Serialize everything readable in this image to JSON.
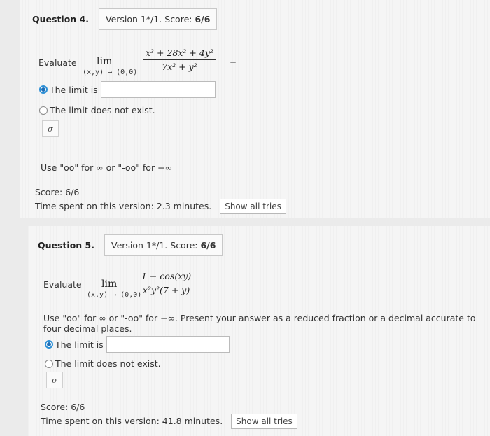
{
  "q4": {
    "title": "Question 4.",
    "version": "Version 1*/1. Score:",
    "score": "6/6",
    "evaluate": "Evaluate",
    "lim": "lim",
    "lim_sub": "(x,y) → (0,0)",
    "numerator": "x³ + 28x² + 4y²",
    "denominator": "7x² + y²",
    "eq_sign": "=",
    "option_limit": "The limit is",
    "option_dne": "The limit does not exist.",
    "preview_icon": "σ",
    "hint": "Use \"oo\" for ∞ or \"-oo\" for −∞",
    "score_line": "Score: 6/6",
    "time_line": "Time spent on this version: 2.3 minutes.",
    "show_tries": "Show all tries"
  },
  "q5": {
    "title": "Question 5.",
    "version": "Version 1*/1. Score:",
    "score": "6/6",
    "evaluate": "Evaluate",
    "lim": "lim",
    "lim_sub": "(x,y) → (0,0)",
    "numerator": "1 − cos(xy)",
    "denominator": "x²y²(7 + y)",
    "hint": "Use \"oo\" for ∞ or \"-oo\" for −∞. Present your answer as a reduced fraction or a decimal accurate to four decimal places.",
    "option_limit": "The limit is",
    "option_dne": "The limit does not exist.",
    "preview_icon": "σ",
    "score_line": "Score: 6/6",
    "time_line": "Time spent on this version: 41.8 minutes.",
    "show_tries": "Show all tries"
  }
}
